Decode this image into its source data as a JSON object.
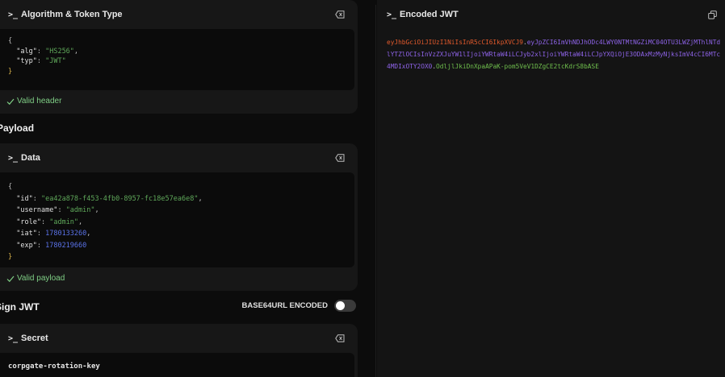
{
  "header_card": {
    "title": "Algorithm & Token Type",
    "json_lines": [
      {
        "open": "{"
      },
      {
        "key": "\"alg\"",
        "value": "\"HS256\"",
        "comma": ","
      },
      {
        "key": "\"typ\"",
        "value": "\"JWT\"",
        "comma": ""
      },
      {
        "close": "}"
      }
    ],
    "status": "Valid header"
  },
  "payload_section": {
    "title": "Payload"
  },
  "data_card": {
    "title": "Data",
    "status": "Valid payload",
    "fields": {
      "id": "\"ea42a878-f453-4fb0-8957-fc18e57ea6e8\"",
      "username": "\"admin\"",
      "role": "\"admin\"",
      "iat": "1780133260",
      "exp": "1780219660"
    },
    "keys": {
      "id": "\"id\"",
      "username": "\"username\"",
      "role": "\"role\"",
      "iat": "\"iat\"",
      "exp": "\"exp\""
    }
  },
  "sign_section": {
    "title": "Sign JWT",
    "toggle_label": "BASE64URL ENCODED",
    "toggle_on": false
  },
  "secret_card": {
    "title": "Secret",
    "value": "corpgate-rotation-key"
  },
  "encoded_panel": {
    "title": "Encoded JWT",
    "header_part": "eyJhbGciOiJIUzI1NiIsInR5cCI6IkpXVCJ9",
    "payload_part": "eyJpZCI6ImVhNDJhODc4LWY0NTMtNGZiMC04OTU3LWZjMThlNTdlYTZlOCIsInVzZXJuYW1lIjoiYWRtaW4iLCJyb2xlIjoiYWRtaW4iLCJpYXQiOjE3ODAxMzMyNjksImV4cCI6MTc4MDIxOTY2OX0",
    "signature_part": "OdljlJkiDnXpaAPaK-pom5VeV1DZgCE2tcKdrS8bASE",
    "dot": "."
  },
  "colors": {
    "valid": "#7fce85",
    "jwt_header": "#e35a2c",
    "jwt_payload": "#8e63e8",
    "jwt_signature": "#6fbf4d"
  },
  "icons": {
    "prompt": ">_",
    "clear": "backspace-icon",
    "copy": "copy-icon",
    "check": "check-icon"
  }
}
